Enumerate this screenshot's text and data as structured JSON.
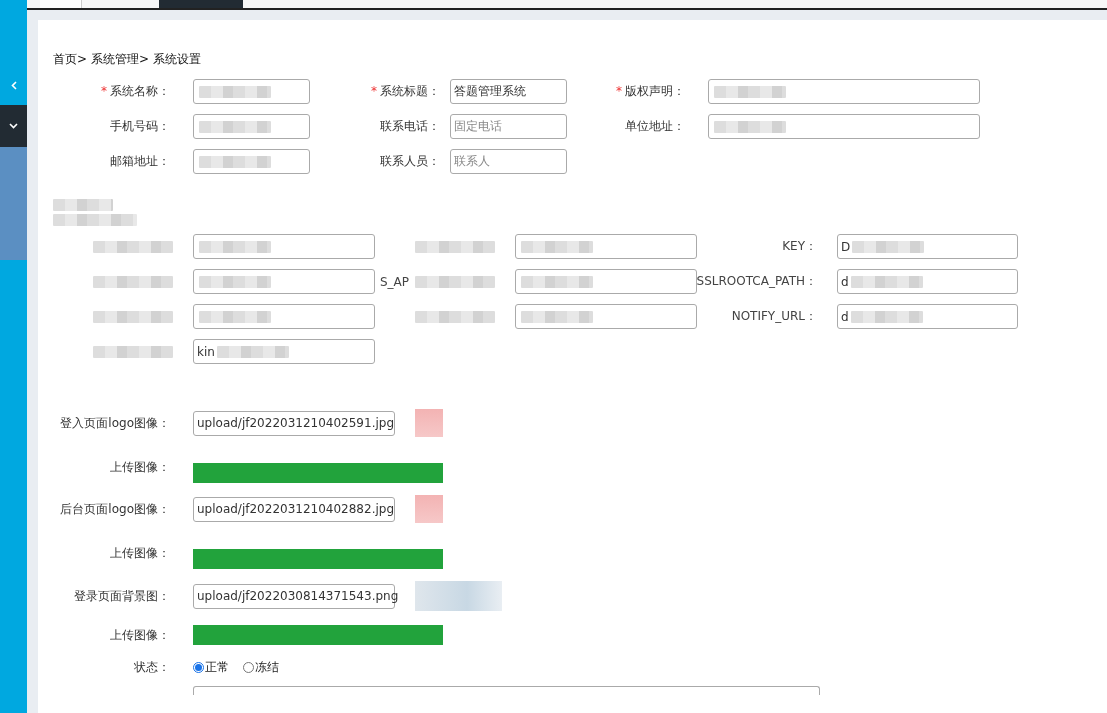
{
  "top_tabs": [
    {
      "selected": false
    },
    {
      "selected": true
    }
  ],
  "breadcrumb": [
    "首页>",
    "系统管理>",
    "系统设置"
  ],
  "basic_fields": [
    {
      "required_mark": "*",
      "label": "系统名称：",
      "redacted": true
    },
    {
      "required_mark": "*",
      "label": "系统标题：",
      "value": "答题管理系统"
    },
    {
      "required_mark": "*",
      "label": "版权声明：",
      "redacted": true
    },
    {
      "label": "手机号码：",
      "redacted": true
    },
    {
      "label": "联系电话：",
      "placeholder": "固定电话"
    },
    {
      "label": "单位地址：",
      "redacted": true
    },
    {
      "label": "邮箱地址：",
      "redacted": true
    },
    {
      "label": "联系人员：",
      "placeholder": "联系人"
    }
  ],
  "payment_rows": [
    [
      {
        "redacted": true
      },
      {
        "redacted": true
      },
      {
        "label": "KEY：",
        "value": "D",
        "redacted": true
      }
    ],
    [
      {
        "redacted": true
      },
      {
        "label": "S_AP",
        "redacted": true
      },
      {
        "label": "SSLROOTCA_PATH：",
        "value": "d",
        "redacted": true
      }
    ],
    [
      {
        "redacted": true
      },
      {
        "redacted": true
      },
      {
        "label": "NOTIFY_URL：",
        "value": "d",
        "redacted": true
      }
    ],
    [
      {
        "value": "kin",
        "redacted": true
      }
    ]
  ],
  "images": [
    {
      "label": "登入页面logo图像：",
      "value": "upload/jf2022031210402591.jpg",
      "kind": "logo",
      "upload_label": "上传图像："
    },
    {
      "label": "后台页面logo图像：",
      "value": "upload/jf2022031210402882.jpg",
      "kind": "logo",
      "upload_label": "上传图像："
    },
    {
      "label": "登录页面背景图：",
      "value": "upload/jf2022030814371543.png",
      "kind": "background",
      "upload_label": "上传图像："
    }
  ],
  "status": {
    "label": "状态：",
    "options": [
      {
        "label": "正常",
        "selected": true
      },
      {
        "label": "冻结",
        "selected": false
      }
    ]
  }
}
